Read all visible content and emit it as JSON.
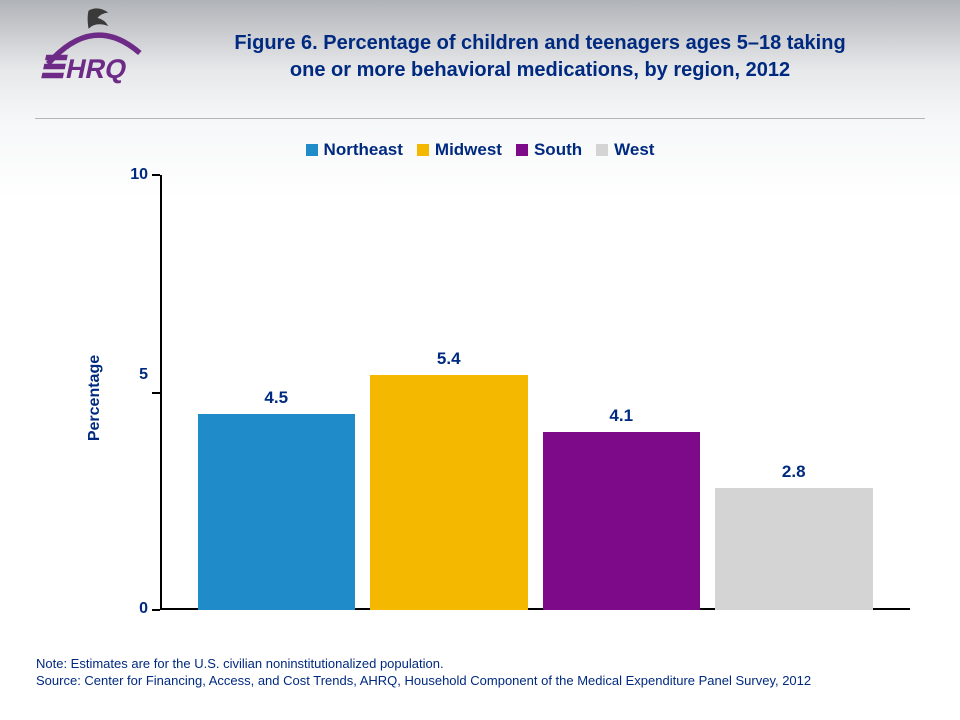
{
  "chart_data": {
    "type": "bar",
    "categories": [
      "Northeast",
      "Midwest",
      "South",
      "West"
    ],
    "values": [
      4.5,
      5.4,
      4.1,
      2.8
    ],
    "title": "Figure 6. Percentage of children and teenagers ages 5–18 taking one or more behavioral medications, by region, 2012",
    "xlabel": "",
    "ylabel": "Percentage",
    "ylim": [
      0,
      10
    ],
    "yticks": [
      0,
      5,
      10
    ],
    "colors": [
      "#1f8bc8",
      "#f5b800",
      "#7d0a88",
      "#d4d4d4"
    ]
  },
  "title_line1": "Figure 6. Percentage of children and teenagers ages 5–18 taking",
  "title_line2": "one or more behavioral medications, by region, 2012",
  "legend": {
    "items": [
      {
        "label": "Northeast",
        "color": "#1f8bc8"
      },
      {
        "label": "Midwest",
        "color": "#f5b800"
      },
      {
        "label": "South",
        "color": "#7d0a88"
      },
      {
        "label": "West",
        "color": "#d4d4d4"
      }
    ]
  },
  "yticks": {
    "t0": "0",
    "t1": "5",
    "t2": "10"
  },
  "bar_labels": {
    "b0": "4.5",
    "b1": "5.4",
    "b2": "4.1",
    "b3": "2.8"
  },
  "footnote": {
    "note": "Note: Estimates are for the U.S. civilian noninstitutionalized population.",
    "source": "Source: Center for Financing, Access, and Cost Trends, AHRQ, Household Component of the Medical Expenditure Panel Survey, 2012"
  },
  "brand": "AHRQ"
}
